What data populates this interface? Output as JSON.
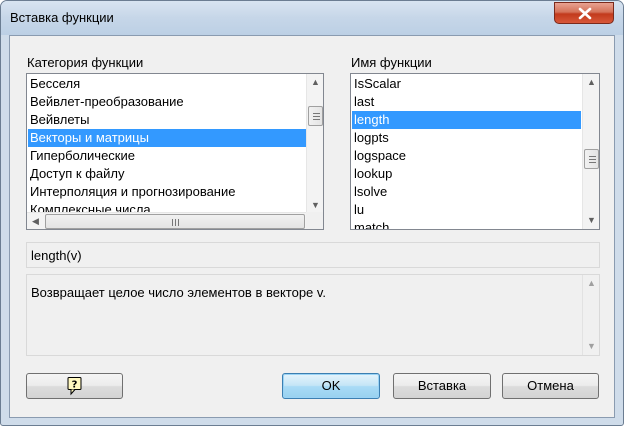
{
  "window": {
    "title": "Вставка функции"
  },
  "category": {
    "label": "Категория функции",
    "items": [
      "Бесселя",
      "Вейвлет-преобразование",
      "Вейвлеты",
      "Векторы и матрицы",
      "Гиперболические",
      "Доступ к файлу",
      "Интерполяция и прогнозирование",
      "Комплексные числа"
    ],
    "selected_index": 3
  },
  "function": {
    "label": "Имя функции",
    "items": [
      "IsScalar",
      "last",
      "length",
      "logpts",
      "logspace",
      "lookup",
      "lsolve",
      "lu",
      "match"
    ],
    "selected_index": 2
  },
  "signature": "length(v)",
  "description": "Возвращает целое число элементов в векторе v.",
  "buttons": {
    "ok": "OK",
    "insert": "Вставка",
    "cancel": "Отмена"
  },
  "icons": {
    "close": "close-icon",
    "help": "help-icon"
  }
}
